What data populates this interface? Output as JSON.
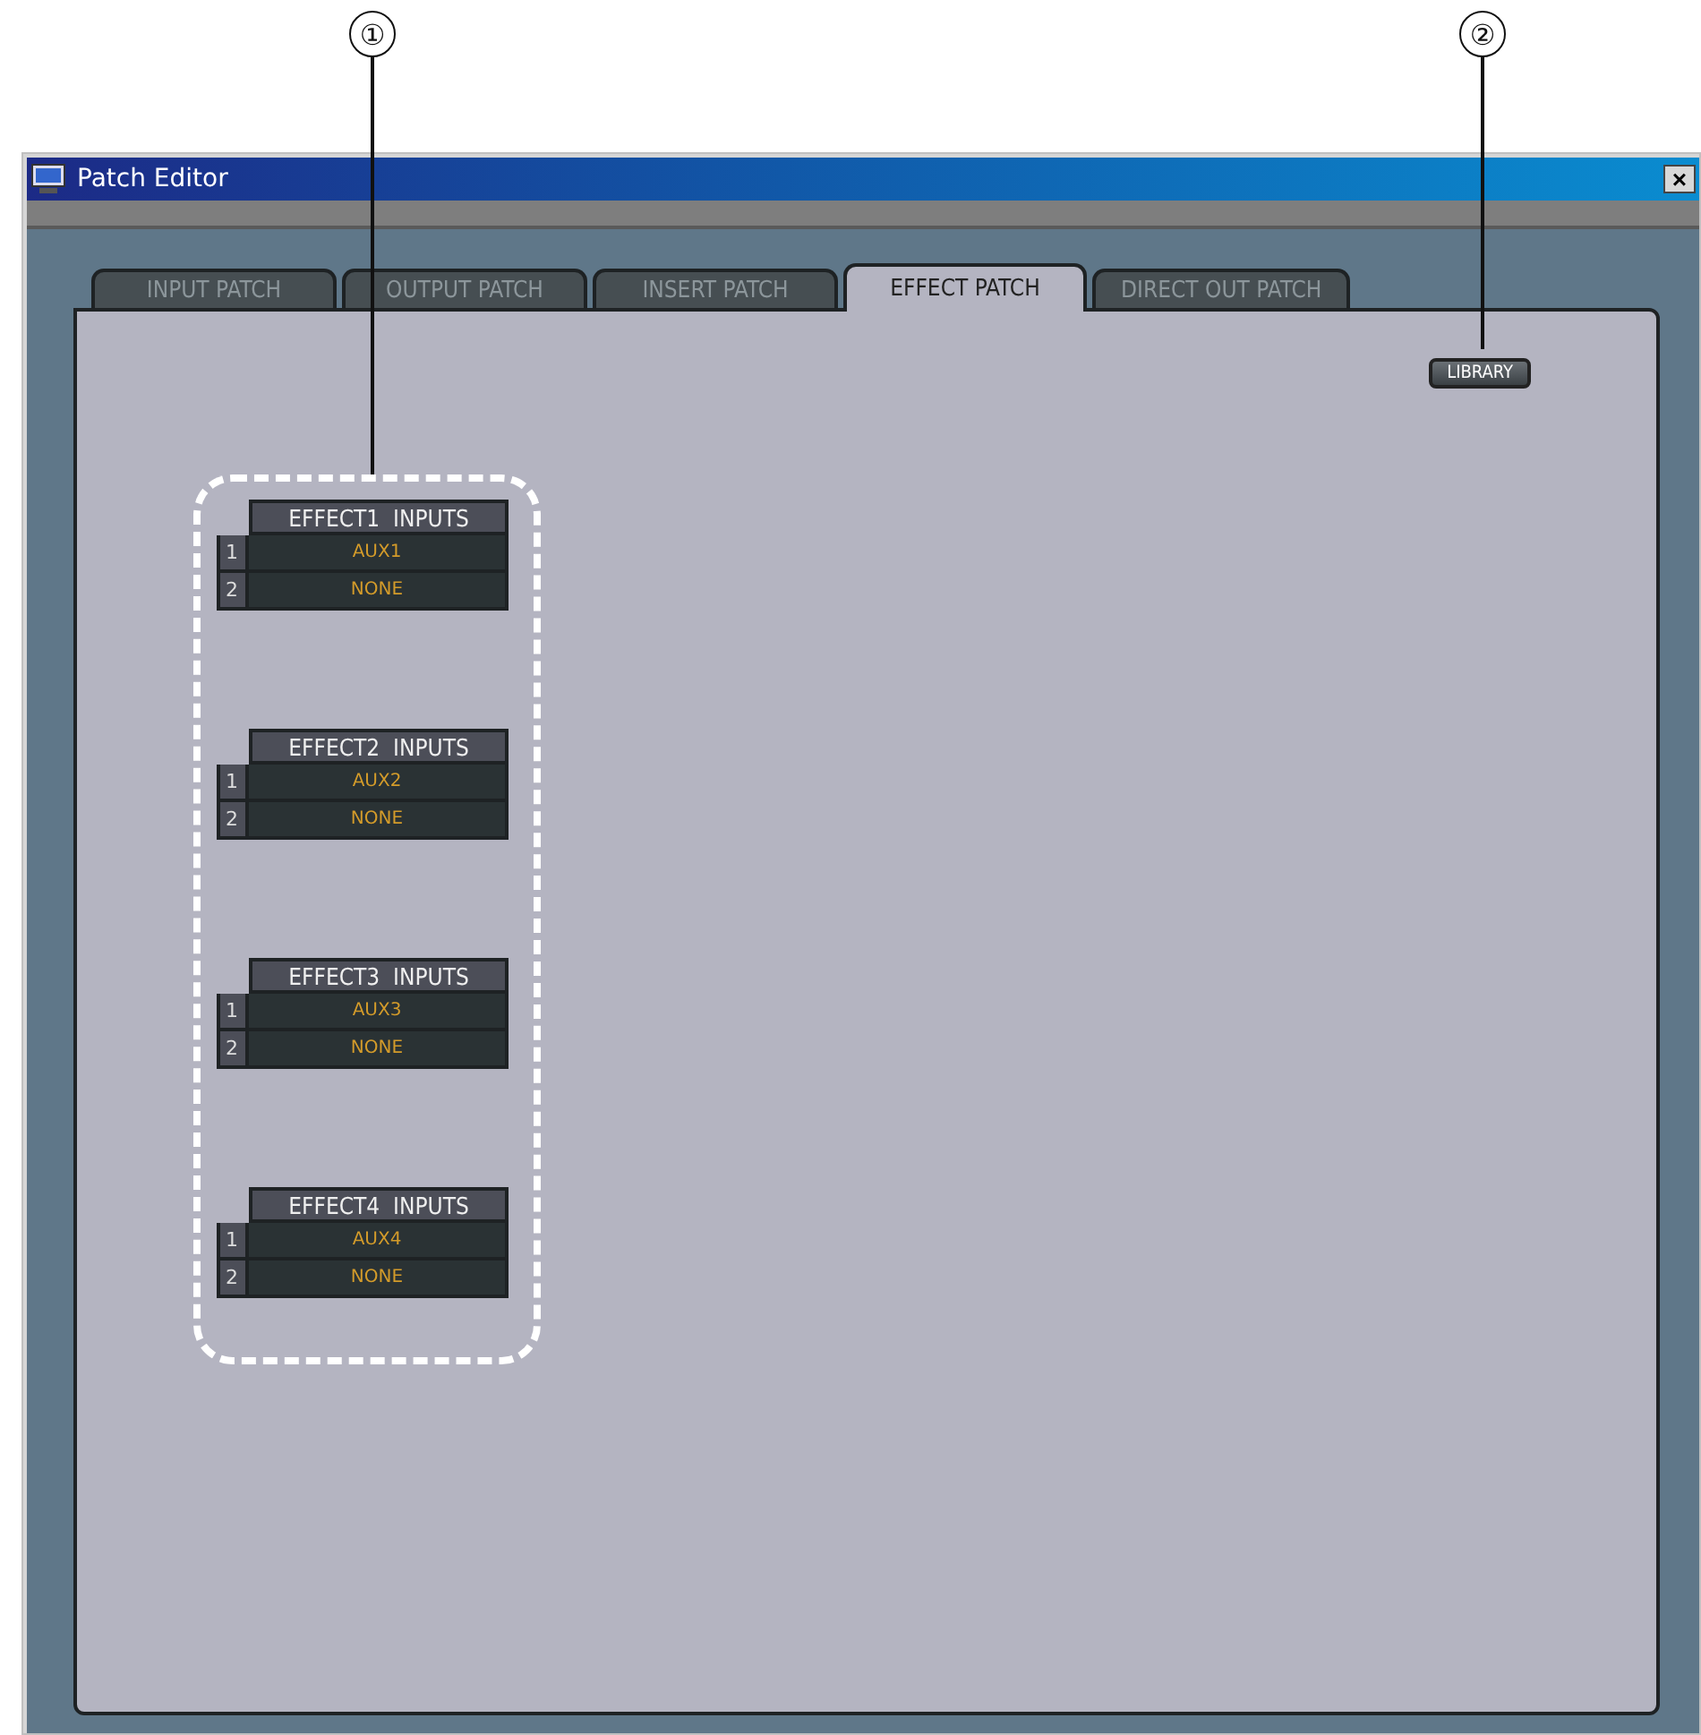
{
  "callouts": [
    {
      "label": "①"
    },
    {
      "label": "②"
    }
  ],
  "window": {
    "title": "Patch Editor",
    "close": "×"
  },
  "tabs": [
    {
      "label": "INPUT PATCH",
      "selected": false
    },
    {
      "label": "OUTPUT PATCH",
      "selected": false
    },
    {
      "label": "INSERT PATCH",
      "selected": false
    },
    {
      "label": "EFFECT PATCH",
      "selected": true
    },
    {
      "label": "DIRECT OUT PATCH",
      "selected": false
    }
  ],
  "library_button": "LIBRARY",
  "effect_inputs": [
    {
      "title": "EFFECT1  INPUTS",
      "rows": [
        {
          "number": "1",
          "source": "AUX1"
        },
        {
          "number": "2",
          "source": "NONE"
        }
      ]
    },
    {
      "title": "EFFECT2  INPUTS",
      "rows": [
        {
          "number": "1",
          "source": "AUX2"
        },
        {
          "number": "2",
          "source": "NONE"
        }
      ]
    },
    {
      "title": "EFFECT3  INPUTS",
      "rows": [
        {
          "number": "1",
          "source": "AUX3"
        },
        {
          "number": "2",
          "source": "NONE"
        }
      ]
    },
    {
      "title": "EFFECT4  INPUTS",
      "rows": [
        {
          "number": "1",
          "source": "AUX4"
        },
        {
          "number": "2",
          "source": "NONE"
        }
      ]
    }
  ]
}
